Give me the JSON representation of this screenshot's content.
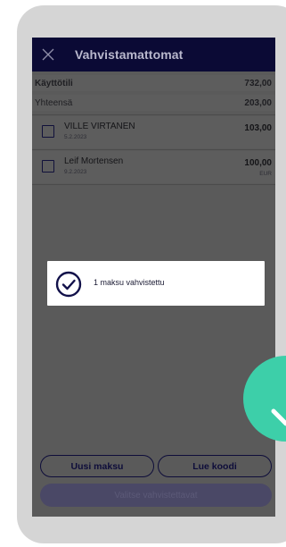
{
  "header": {
    "title": "Vahvistamattomat",
    "close_icon": "close-icon"
  },
  "summary": {
    "account_label": "Käyttötili",
    "account_value": "732,00",
    "total_label": "Yhteensä",
    "total_value": "203,00"
  },
  "payments": [
    {
      "payee": "VILLE VIRTANEN",
      "date": "5.2.2023",
      "amount": "103,00",
      "currency": ""
    },
    {
      "payee": "Leif Mortensen",
      "date": "9.2.2023",
      "amount": "100,00",
      "currency": "EUR"
    }
  ],
  "toast": {
    "icon": "check-circle-icon",
    "message": "1 maksu vahvistettu"
  },
  "actions": {
    "new_payment": "Uusi maksu",
    "read_code": "Lue koodi",
    "select_to_confirm": "Valitse vahvistettavat"
  },
  "colors": {
    "header_bg": "#0b0a35",
    "primary": "#0e0d3a",
    "success": "#3dcfa9",
    "overlay": "#5a5a5a"
  }
}
